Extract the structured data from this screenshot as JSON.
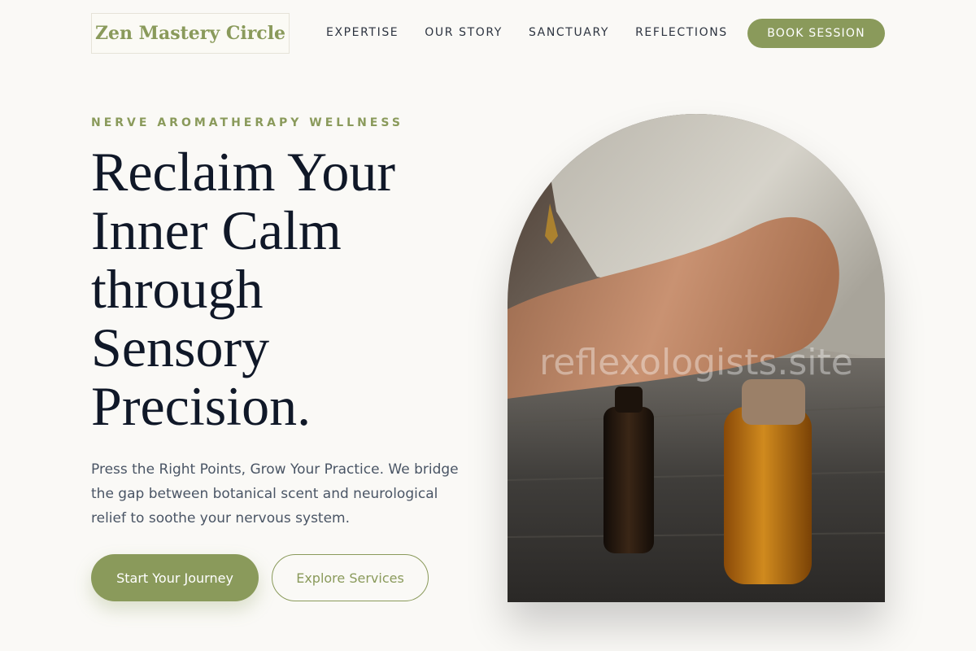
{
  "header": {
    "logo": "Zen Mastery Circle",
    "nav": [
      "EXPERTISE",
      "OUR STORY",
      "SANCTUARY",
      "REFLECTIONS"
    ],
    "cta": "BOOK SESSION"
  },
  "hero": {
    "eyebrow": "NERVE AROMATHERAPY WELLNESS",
    "headline_lines": [
      "Reclaim Your",
      "Inner Calm",
      "through",
      "Sensory",
      "Precision."
    ],
    "description": "Press the Right Points, Grow Your Practice. We bridge the gap between botanical scent and neurological relief to soothe your nervous system.",
    "primary_button": "Start Your Journey",
    "secondary_button": "Explore Services",
    "image_watermark": "reflexologists.site"
  },
  "colors": {
    "accent": "#8a9a5b",
    "background": "#faf9f6",
    "heading": "#101828",
    "body_text": "#4a5565"
  }
}
